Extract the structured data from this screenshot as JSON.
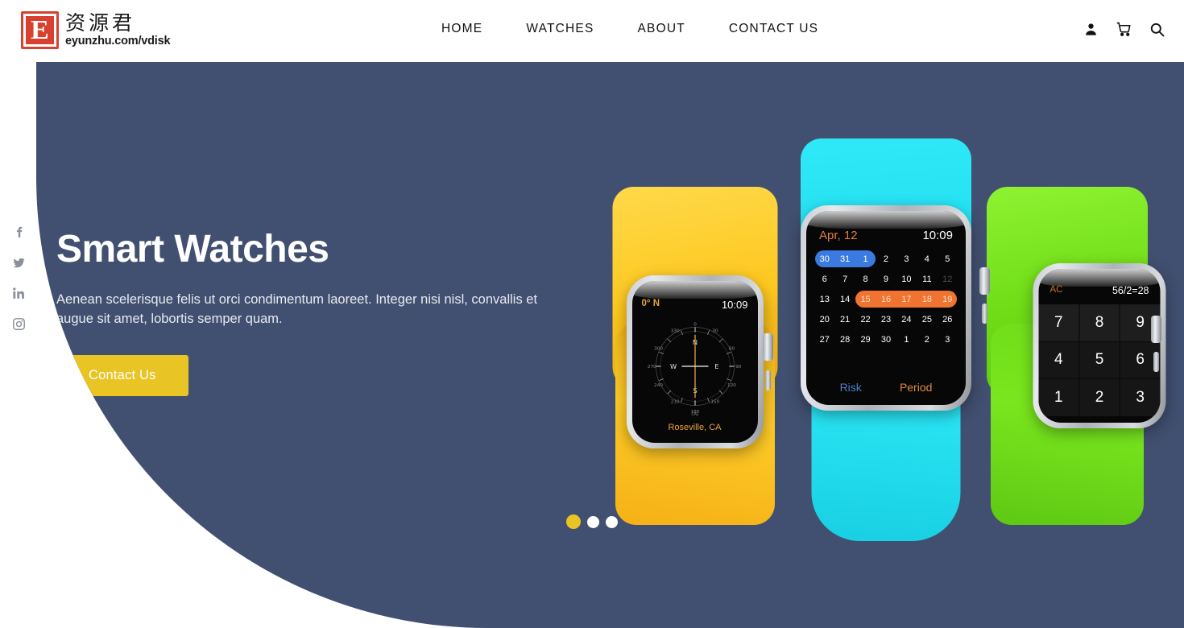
{
  "header": {
    "logo": {
      "mark_letter": "E",
      "chinese": "资源君",
      "url": "eyunzhu.com/vdisk"
    },
    "nav": [
      {
        "label": "HOME"
      },
      {
        "label": "WATCHES"
      },
      {
        "label": "ABOUT"
      },
      {
        "label": "CONTACT US"
      }
    ],
    "icons": [
      {
        "name": "user-icon"
      },
      {
        "name": "cart-icon"
      },
      {
        "name": "search-icon"
      }
    ]
  },
  "social": [
    {
      "name": "facebook-icon"
    },
    {
      "name": "twitter-icon"
    },
    {
      "name": "linkedin-icon"
    },
    {
      "name": "instagram-icon"
    }
  ],
  "hero": {
    "title": "Smart Watches",
    "subtitle": "Aenean scelerisque felis ut orci condimentum laoreet. Integer nisi nisl, convallis et augue sit amet, lobortis semper quam.",
    "cta_label": "Contact Us",
    "background_color": "#414f70",
    "accent_color": "#e8c425"
  },
  "watches": {
    "compass": {
      "band_color": "#fdc81f",
      "heading": "0° N",
      "time": "10:09",
      "location": "Roseville, CA",
      "rose_labels": [
        "N",
        "E",
        "S",
        "W"
      ],
      "rose_degrees": [
        "0",
        "30",
        "60",
        "90",
        "120",
        "150",
        "180",
        "210",
        "240",
        "270",
        "300",
        "330"
      ],
      "rose_footer": "CAL"
    },
    "calendar": {
      "band_color": "#2fe9f8",
      "month": "Apr, 12",
      "time": "10:09",
      "rows": [
        {
          "cells": [
            "30",
            "31",
            "1",
            "2",
            "3",
            "4",
            "5"
          ],
          "highlight": {
            "color": "blue",
            "start": 0,
            "end": 2
          }
        },
        {
          "cells": [
            "6",
            "7",
            "8",
            "9",
            "10",
            "11",
            "12"
          ],
          "dim_index": 6
        },
        {
          "cells": [
            "13",
            "14",
            "15",
            "16",
            "17",
            "18",
            "19"
          ],
          "highlight": {
            "color": "orange",
            "start": 2,
            "end": 6
          }
        },
        {
          "cells": [
            "20",
            "21",
            "22",
            "23",
            "24",
            "25",
            "26"
          ]
        },
        {
          "cells": [
            "27",
            "28",
            "29",
            "30",
            "1",
            "2",
            "3"
          ]
        }
      ],
      "footer_left": "Risk",
      "footer_right": "Period",
      "highlight_blue": "#3b7ae0",
      "highlight_orange": "#f07331"
    },
    "calculator": {
      "band_color": "#6fdc16",
      "clear_label": "AC",
      "expression": "56/2=28",
      "keys": [
        "7",
        "8",
        "9",
        "4",
        "5",
        "6",
        "1",
        "2",
        "3"
      ]
    }
  },
  "carousel": {
    "dots": [
      {
        "active": true
      },
      {
        "active": false
      },
      {
        "active": false
      }
    ],
    "active_color": "#e8c425",
    "inactive_color": "#ffffff"
  }
}
